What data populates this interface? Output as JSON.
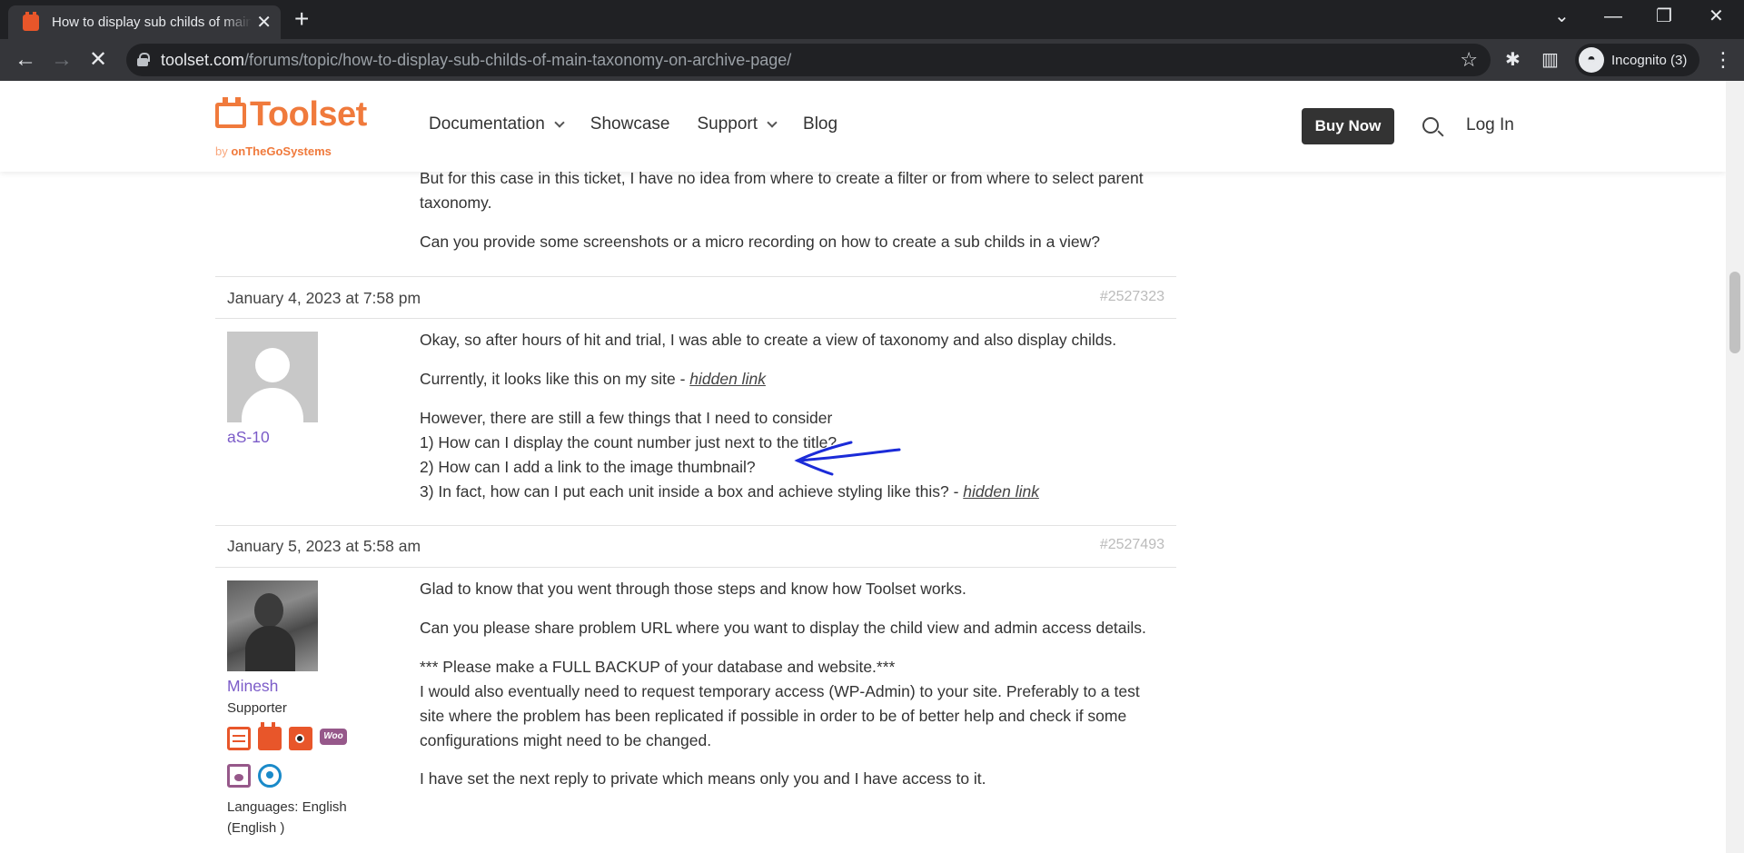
{
  "browser": {
    "tab_title": "How to display sub childs of main taxonomy on archive page",
    "tab_close": "✕",
    "new_tab": "+",
    "url_host": "toolset.com",
    "url_path": "/forums/topic/how-to-display-sub-childs-of-main-taxonomy-on-archive-page/",
    "incognito_label": "Incognito (3)",
    "controls": {
      "dropdown": "⌄",
      "minimize": "—",
      "restore": "❐",
      "close": "✕",
      "back": "←",
      "forward": "→",
      "reload": "✕",
      "star": "☆",
      "extensions": "✱",
      "sidepanel": "▥",
      "menu": "⋮",
      "incognito_icon": "◓"
    }
  },
  "site": {
    "logo_text": "Toolset",
    "logo_by": "by",
    "logo_company": "onTheGoSystems",
    "nav": [
      "Documentation",
      "Showcase",
      "Support",
      "Blog"
    ],
    "buy_now": "Buy Now",
    "login": "Log In",
    "accent_color": "#f07a3c"
  },
  "thread": {
    "top_paragraphs": [
      "But for this case in this ticket, I have no idea from where to create a filter or from where to select parent taxonomy.",
      "Can you provide some screenshots or a micro recording on how to create a sub childs in a view?"
    ],
    "posts": [
      {
        "date": "January 4, 2023 at 7:58 pm",
        "id": "#2527323",
        "author": "aS-10",
        "p1": "Okay, so after hours of hit and trial, I was able to create a view of taxonomy and also display childs.",
        "p2_text": "Currently, it looks like this on my site - ",
        "p2_link": "hidden link",
        "p3_lines": [
          "However, there are still a few things that I need to consider",
          "1) How can I display the count number just next to the title?",
          "2) How can I add a link to the image thumbnail?"
        ],
        "p3_last_text": "3) In fact, how can I put each unit inside a box and achieve styling like this? - ",
        "p3_last_link": "hidden link"
      },
      {
        "date": "January 5, 2023 at 5:58 am",
        "id": "#2527493",
        "author": "Minesh",
        "role": "Supporter",
        "badges": [
          "toolset-types-icon",
          "toolset-blocks-icon",
          "toolset-access-icon",
          "woocommerce-icon",
          "toolset-forms-icon",
          "wpml-icon"
        ],
        "badge_woo_label": "Woo",
        "languages": "Languages: English (English )",
        "p1": "Glad to know that you went through those steps and know how Toolset works.",
        "p2": "Can you please share problem URL where you want to display the child view and admin access details.",
        "p3_line1": "*** Please make a FULL BACKUP of your database and website.***",
        "p3_rest": "I would also eventually need to request temporary access (WP-Admin) to your site. Preferably to a test site where the problem has been replicated if possible in order to be of better help and check if some configurations might need to be changed.",
        "p4": "I have set the next reply to private which means only you and I have access to it."
      }
    ]
  }
}
